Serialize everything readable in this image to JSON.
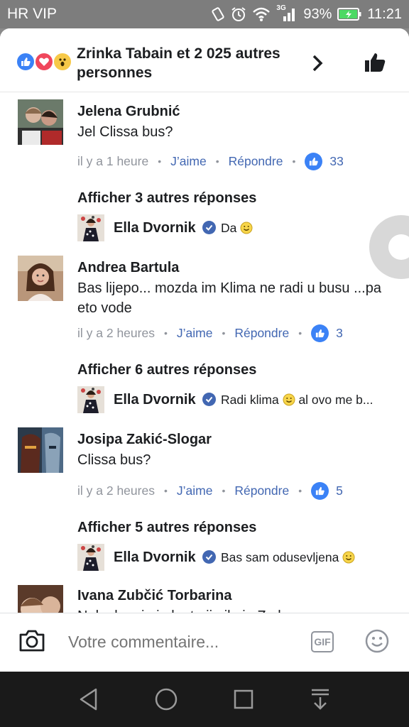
{
  "status_bar": {
    "carrier": "HR VIP",
    "network": "3G",
    "battery": "93%",
    "time": "11:21"
  },
  "header": {
    "reactions": [
      "like-icon",
      "love-icon",
      "wow-icon"
    ],
    "title": "Zrinka Tabain et 2 025 autres personnes"
  },
  "comments": [
    {
      "name": "Jelena Grubnić",
      "text": "Jel Clissa bus?",
      "time": "il y a 1 heure",
      "like_label": "J’aime",
      "reply_label": "Répondre",
      "likes": "33",
      "more_replies": "Afficher 3 autres réponses",
      "reply": {
        "name": "Ella Dvornik",
        "text": "Da"
      }
    },
    {
      "name": "Andrea Bartula",
      "text": "Bas lijepo... mozda im Klima ne radi u busu ...pa eto vode",
      "time": "il y a 2 heures",
      "like_label": "J’aime",
      "reply_label": "Répondre",
      "likes": "3",
      "more_replies": "Afficher 6 autres réponses",
      "reply": {
        "name": "Ella Dvornik",
        "text_before": "Radi klima",
        "text_after": "al ovo me b..."
      }
    },
    {
      "name": "Josipa Zakić-Slogar",
      "text": "Clissa bus?",
      "time": "il y a 2 heures",
      "like_label": "J’aime",
      "reply_label": "Répondre",
      "likes": "5",
      "more_replies": "Afficher 5 autres réponses",
      "reply": {
        "name": "Ella Dvornik",
        "text": "Bas sam odusevljena"
      }
    },
    {
      "name": "Ivana Zubčić Torbarina",
      "text": "Nek...k...ni...i...k...t...ji...il...j...Z...l"
    }
  ],
  "composer": {
    "placeholder": "Votre commentaire...",
    "gif_label": "GIF"
  },
  "nav_bar": {
    "buttons": [
      "back-icon",
      "home-icon",
      "recents-icon",
      "notification-pull-icon"
    ]
  },
  "colors": {
    "link": "#4267b2",
    "like_blue": "#3b82f6",
    "love_red": "#f0475c",
    "wow_yellow": "#f7c948",
    "meta_gray": "#90949c"
  }
}
